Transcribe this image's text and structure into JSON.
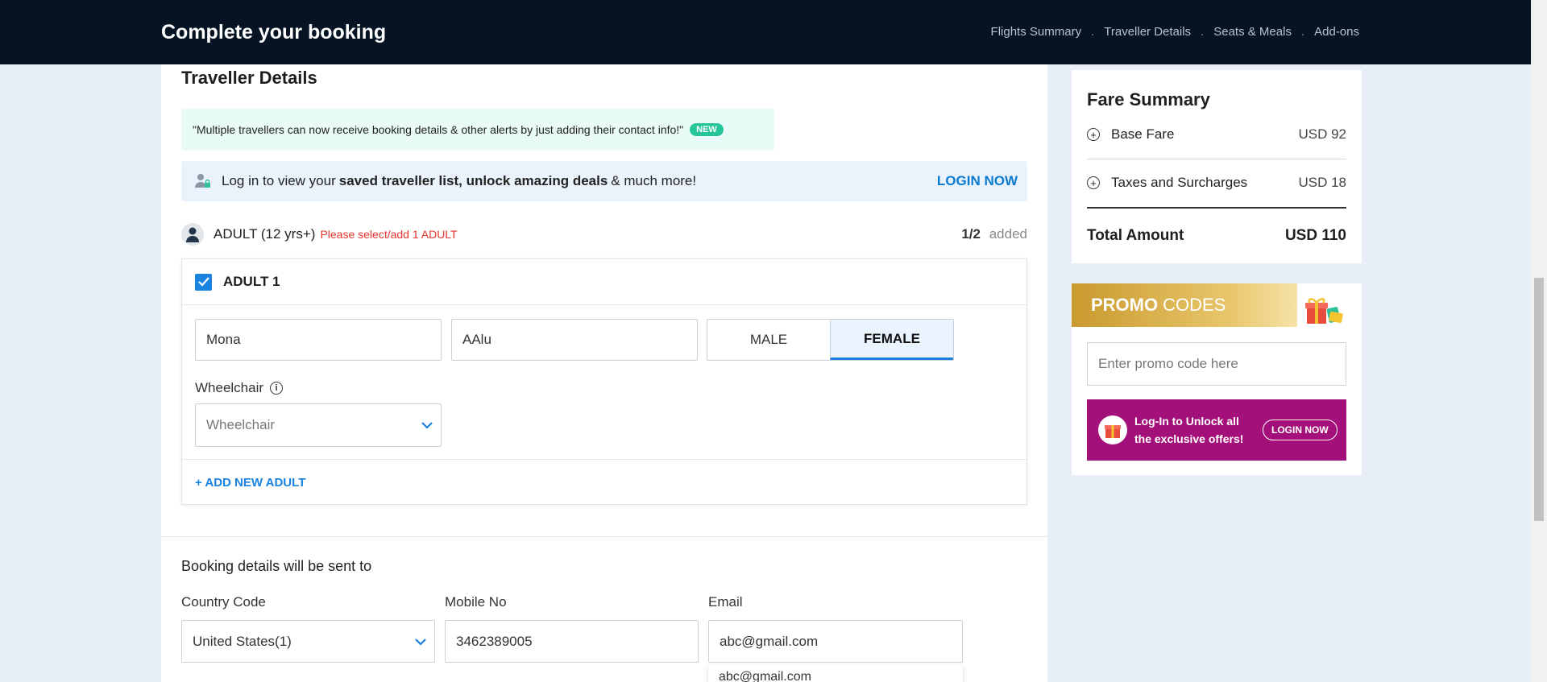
{
  "header": {
    "title": "Complete your booking",
    "steps": [
      "Flights Summary",
      "Traveller Details",
      "Seats & Meals",
      "Add-ons"
    ],
    "separator": "."
  },
  "traveller": {
    "section_title": "Traveller Details",
    "info_banner_text": "\"Multiple travellers can now receive booking details & other alerts by just adding their contact info!\"",
    "new_badge": "NEW",
    "login_strip": {
      "prefix": "Log in to view your ",
      "bold": "saved traveller list, unlock amazing deals",
      "suffix": " & much more!",
      "login_label": "LOGIN NOW"
    },
    "adult": {
      "title": "ADULT (12 yrs+)",
      "warning": "Please select/add 1 ADULT",
      "count": "1/2",
      "count_suffix": "added"
    },
    "adult_card": {
      "label": "ADULT 1",
      "first_name": "Mona",
      "last_name": "AAlu",
      "gender_options": [
        "MALE",
        "FEMALE"
      ],
      "selected_gender": "FEMALE",
      "wheelchair_label": "Wheelchair",
      "wheelchair_value": "Wheelchair",
      "add_new_label": "+ ADD NEW ADULT"
    }
  },
  "booking_contact": {
    "title": "Booking details will be sent to",
    "country_label": "Country Code",
    "country_value": "United States(1)",
    "mobile_label": "Mobile No",
    "mobile_value": "3462389005",
    "email_label": "Email",
    "email_value": "abc@gmail.com",
    "email_suggestion": "abc@gmail.com"
  },
  "fare_summary": {
    "title": "Fare Summary",
    "rows": [
      {
        "label": "Base Fare",
        "amount": "USD 92"
      },
      {
        "label": "Taxes and Surcharges",
        "amount": "USD 18"
      }
    ],
    "total_label": "Total Amount",
    "total_amount": "USD 110"
  },
  "promo": {
    "title_bold": "PROMO",
    "title_light": " CODES",
    "input_placeholder": "Enter promo code here",
    "banner_text": "Log-In to Unlock all the exclusive offers!",
    "banner_button": "LOGIN NOW"
  },
  "colors": {
    "header_bg": "#051322",
    "accent_blue": "#1a82e0",
    "warning_red": "#e5342c",
    "promo_magenta": "#a4107a",
    "new_badge_green": "#27c59a"
  }
}
